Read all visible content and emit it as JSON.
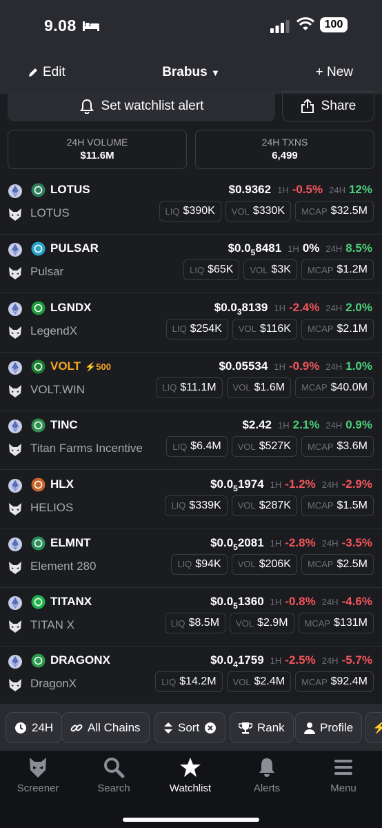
{
  "status_bar": {
    "time": "9.08",
    "battery": "100"
  },
  "header": {
    "edit_label": "Edit",
    "title": "Brabus",
    "new_label": "+ New"
  },
  "actions": {
    "alert_label": "Set watchlist alert",
    "share_label": "Share"
  },
  "stats": {
    "volume_label": "24H VOLUME",
    "volume_value": "$11.6M",
    "txns_label": "24H TXNS",
    "txns_value": "6,499"
  },
  "labels": {
    "h1": "1H",
    "h24": "24H",
    "liq": "LIQ",
    "vol": "VOL",
    "mcap": "MCAP"
  },
  "tokens": [
    {
      "symbol": "LOTUS",
      "name": "LOTUS",
      "price": "$0.9362",
      "price_sub": "",
      "price_tail": "",
      "h1": "-0.5%",
      "h24": "12%",
      "liq": "$390K",
      "vol": "$330K",
      "mcap": "$32.5M",
      "logo_color": "#2e7d5a"
    },
    {
      "symbol": "PULSAR",
      "name": "Pulsar",
      "price": "$0.0",
      "price_sub": "5",
      "price_tail": "8481",
      "h1": "0%",
      "h24": "8.5%",
      "liq": "$65K",
      "vol": "$3K",
      "mcap": "$1.2M",
      "logo_color": "#2ba3c9"
    },
    {
      "symbol": "LGNDX",
      "name": "LegendX",
      "price": "$0.0",
      "price_sub": "3",
      "price_tail": "8139",
      "h1": "-2.4%",
      "h24": "2.0%",
      "liq": "$254K",
      "vol": "$116K",
      "mcap": "$2.1M",
      "logo_color": "#1f9a3a"
    },
    {
      "symbol": "VOLT",
      "name": "VOLT.WIN",
      "price": "$0.05534",
      "price_sub": "",
      "price_tail": "",
      "h1": "-0.9%",
      "h24": "1.0%",
      "liq": "$11.1M",
      "vol": "$1.6M",
      "mcap": "$40.0M",
      "logo_color": "#1b7d2f",
      "badge": "⚡500"
    },
    {
      "symbol": "TINC",
      "name": "Titan Farms Incentive",
      "price": "$2.42",
      "price_sub": "",
      "price_tail": "",
      "h1": "2.1%",
      "h24": "0.9%",
      "liq": "$6.4M",
      "vol": "$527K",
      "mcap": "$3.6M",
      "logo_color": "#2e8f4e"
    },
    {
      "symbol": "HLX",
      "name": "HELIOS",
      "price": "$0.0",
      "price_sub": "5",
      "price_tail": "1974",
      "h1": "-1.2%",
      "h24": "-2.9%",
      "liq": "$339K",
      "vol": "$287K",
      "mcap": "$1.5M",
      "logo_color": "#c8642a"
    },
    {
      "symbol": "ELMNT",
      "name": "Element 280",
      "price": "$0.0",
      "price_sub": "5",
      "price_tail": "2081",
      "h1": "-2.8%",
      "h24": "-3.5%",
      "liq": "$94K",
      "vol": "$206K",
      "mcap": "$2.5M",
      "logo_color": "#2a8f5a"
    },
    {
      "symbol": "TITANX",
      "name": "TITAN X",
      "price": "$0.0",
      "price_sub": "5",
      "price_tail": "1360",
      "h1": "-0.8%",
      "h24": "-4.6%",
      "liq": "$8.5M",
      "vol": "$2.9M",
      "mcap": "$131M",
      "logo_color": "#1fb34a"
    },
    {
      "symbol": "DRAGONX",
      "name": "DragonX",
      "price": "$0.0",
      "price_sub": "4",
      "price_tail": "1759",
      "h1": "-2.5%",
      "h24": "-5.7%",
      "liq": "$14.2M",
      "vol": "$2.4M",
      "mcap": "$92.4M",
      "logo_color": "#2a9a4a"
    }
  ],
  "filters": {
    "timeframe": "24H",
    "chains": "All Chains",
    "sort": "Sort",
    "rank": "Rank",
    "profile": "Profile"
  },
  "tabbar": {
    "screener": "Screener",
    "search": "Search",
    "watchlist": "Watchlist",
    "alerts": "Alerts",
    "menu": "Menu"
  },
  "colors": {
    "positive": "#4bd17a",
    "negative": "#f2565b",
    "volt_accent": "#f5a623"
  }
}
